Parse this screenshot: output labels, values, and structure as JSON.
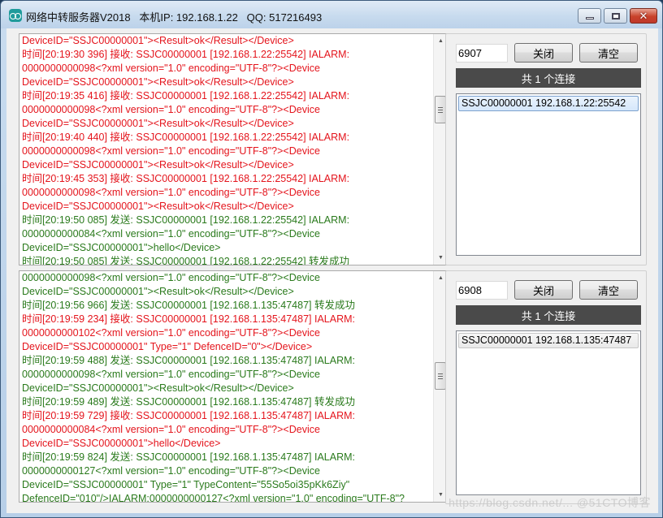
{
  "window": {
    "title": "网络中转服务器V2018   本机IP: 192.168.1.22   QQ: 517216493",
    "controls": {
      "minimize": "minimize",
      "maximize": "maximize",
      "close": "✕"
    }
  },
  "colors": {
    "receive": "#e4141c",
    "send": "#2a7a1c",
    "connection_header_bg": "#4a4a4a"
  },
  "panels": [
    {
      "log": [
        {
          "type": "recv",
          "text": "DeviceID=\"SSJC00000001\"><Result>ok</Result></Device>"
        },
        {
          "type": "recv",
          "text": "时间[20:19:30 396] 接收: SSJC00000001 [192.168.1.22:25542] IALARM:"
        },
        {
          "type": "recv",
          "text": "0000000000098<?xml version=\"1.0\" encoding=\"UTF-8\"?><Device"
        },
        {
          "type": "recv",
          "text": "DeviceID=\"SSJC00000001\"><Result>ok</Result></Device>"
        },
        {
          "type": "recv",
          "text": "时间[20:19:35 416] 接收: SSJC00000001 [192.168.1.22:25542] IALARM:"
        },
        {
          "type": "recv",
          "text": "0000000000098<?xml version=\"1.0\" encoding=\"UTF-8\"?><Device"
        },
        {
          "type": "recv",
          "text": "DeviceID=\"SSJC00000001\"><Result>ok</Result></Device>"
        },
        {
          "type": "recv",
          "text": "时间[20:19:40 440] 接收: SSJC00000001 [192.168.1.22:25542] IALARM:"
        },
        {
          "type": "recv",
          "text": "0000000000098<?xml version=\"1.0\" encoding=\"UTF-8\"?><Device"
        },
        {
          "type": "recv",
          "text": "DeviceID=\"SSJC00000001\"><Result>ok</Result></Device>"
        },
        {
          "type": "recv",
          "text": "时间[20:19:45 353] 接收: SSJC00000001 [192.168.1.22:25542] IALARM:"
        },
        {
          "type": "recv",
          "text": "0000000000098<?xml version=\"1.0\" encoding=\"UTF-8\"?><Device"
        },
        {
          "type": "recv",
          "text": "DeviceID=\"SSJC00000001\"><Result>ok</Result></Device>"
        },
        {
          "type": "send",
          "text": "时间[20:19:50 085] 发送: SSJC00000001 [192.168.1.22:25542] IALARM:"
        },
        {
          "type": "send",
          "text": "0000000000084<?xml version=\"1.0\" encoding=\"UTF-8\"?><Device"
        },
        {
          "type": "send",
          "text": "DeviceID=\"SSJC00000001\">hello</Device>"
        },
        {
          "type": "send",
          "text": "时间[20:19:50 085] 发送: SSJC00000001 [192.168.1.22:25542] 转发成功"
        }
      ],
      "port": "6907",
      "close_label": "关闭",
      "clear_label": "清空",
      "connection_count_label": "共 1 个连接",
      "connections": [
        "SSJC00000001 192.168.1.22:25542"
      ]
    },
    {
      "log": [
        {
          "type": "send",
          "text": "0000000000098<?xml version=\"1.0\" encoding=\"UTF-8\"?><Device"
        },
        {
          "type": "send",
          "text": "DeviceID=\"SSJC00000001\"><Result>ok</Result></Device>"
        },
        {
          "type": "send",
          "text": "时间[20:19:56 966] 发送: SSJC00000001 [192.168.1.135:47487] 转发成功"
        },
        {
          "type": "recv",
          "text": "时间[20:19:59 234] 接收: SSJC00000001 [192.168.1.135:47487] IALARM:"
        },
        {
          "type": "recv",
          "text": "0000000000102<?xml version=\"1.0\" encoding=\"UTF-8\"?><Device"
        },
        {
          "type": "recv",
          "text": "DeviceID=\"SSJC00000001\" Type=\"1\" DefenceID=\"0\"></Device>"
        },
        {
          "type": "send",
          "text": "时间[20:19:59 488] 发送: SSJC00000001 [192.168.1.135:47487] IALARM:"
        },
        {
          "type": "send",
          "text": "0000000000098<?xml version=\"1.0\" encoding=\"UTF-8\"?><Device"
        },
        {
          "type": "send",
          "text": "DeviceID=\"SSJC00000001\"><Result>ok</Result></Device>"
        },
        {
          "type": "send",
          "text": "时间[20:19:59 489] 发送: SSJC00000001 [192.168.1.135:47487] 转发成功"
        },
        {
          "type": "recv",
          "text": "时间[20:19:59 729] 接收: SSJC00000001 [192.168.1.135:47487] IALARM:"
        },
        {
          "type": "recv",
          "text": "0000000000084<?xml version=\"1.0\" encoding=\"UTF-8\"?><Device"
        },
        {
          "type": "recv",
          "text": "DeviceID=\"SSJC00000001\">hello</Device>"
        },
        {
          "type": "send",
          "text": "时间[20:19:59 824] 发送: SSJC00000001 [192.168.1.135:47487] IALARM:"
        },
        {
          "type": "send",
          "text": "0000000000127<?xml version=\"1.0\" encoding=\"UTF-8\"?><Device"
        },
        {
          "type": "send",
          "text": "DeviceID=\"SSJC00000001\" Type=\"1\" TypeContent=\"55So5oi35pKk6Ziy\""
        },
        {
          "type": "send",
          "text": "DefenceID=\"010\"/>IALARM:0000000000127<?xml version=\"1.0\" encoding=\"UTF-8\"?"
        }
      ],
      "port": "6908",
      "close_label": "关闭",
      "clear_label": "清空",
      "connection_count_label": "共 1 个连接",
      "connections": [
        "SSJC00000001 192.168.1.135:47487"
      ]
    }
  ],
  "scrollbars": {
    "up": "▲",
    "down": "▼"
  },
  "watermark": "https://blog.csdn.net/...  @51CTO博客"
}
